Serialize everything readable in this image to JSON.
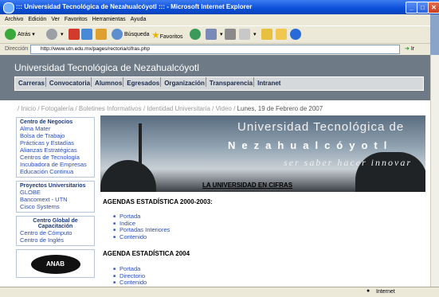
{
  "window": {
    "title": "::: Universidad Tecnológica de Nezahualcóyotl ::: - Microsoft Internet Explorer"
  },
  "menu": [
    "Archivo",
    "Edición",
    "Ver",
    "Favoritos",
    "Herramientas",
    "Ayuda"
  ],
  "toolbar": {
    "back_label": "Atrás",
    "search_label": "Búsqueda",
    "favorites_label": "Favoritos"
  },
  "address": {
    "label": "Dirección",
    "url": "http://www.utn.edu.mx/pages/rectoria/cifras.php",
    "go_label": "Ir"
  },
  "site": {
    "title": "Universidad Tecnológica de Nezahualcóyotl",
    "nav": [
      "Carreras",
      "Convocatoria",
      "Alumnos",
      "Egresados",
      "Organización",
      "Transparencia",
      "Intranet"
    ],
    "breadcrumb": "/ Inicio / Fotogalería / Boletines Informativos / Identidad Universitaria / Video /",
    "date": "Lunes, 19 de Febrero de 2007"
  },
  "sidebar": {
    "negocios_title": "Centro de Negocios",
    "negocios_links": [
      "Alma Mater",
      "Bolsa de Trabajo",
      "Prácticas y Estadías",
      "Alianzas Estratégicas",
      "Centros de Tecnología",
      "Incubadora de Empresas",
      "Educación Continua"
    ],
    "proyectos_title": "Proyectos Universitarios",
    "proyectos_links": [
      "GLOBE",
      "Bancomext - UTN",
      "Cisco Systems"
    ],
    "capacitacion_title": "Centro Global de Capacitación",
    "capacitacion_links": [
      "Centro de Cómputo",
      "Centro de Inglés"
    ],
    "logo_text": "ANAB"
  },
  "banner": {
    "line1": "Universidad Tecnológica de",
    "line2": "Nezahualcóyotl",
    "line3": "ser saber hacer innovar"
  },
  "main": {
    "title": "LA UNIVERSIDAD EN CIFRAS",
    "section1": {
      "heading": "AGENDAS ESTADÍSTICA 2000-2003:",
      "links": [
        "Portada",
        "Indice",
        "Portadas Interiores",
        "Contenido"
      ]
    },
    "section2": {
      "heading": "AGENDA ESTADÍSTICA 2004",
      "links": [
        "Portada",
        "Directorio",
        "Contenido"
      ]
    }
  },
  "status": {
    "zone": "Internet"
  }
}
